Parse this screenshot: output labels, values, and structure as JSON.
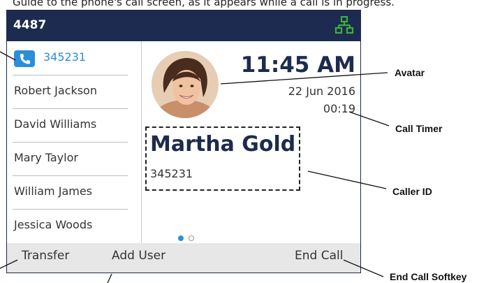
{
  "intro_text": "Guide to the phone's call screen, as it appears while a call is in progress.",
  "phone": {
    "extension": "4487",
    "icons": {
      "network": "network-icon",
      "phone": "phone-icon"
    },
    "contacts": [
      {
        "label": "345231",
        "active": true
      },
      {
        "label": "Robert Jackson"
      },
      {
        "label": "David Williams"
      },
      {
        "label": "Mary Taylor"
      },
      {
        "label": "William James"
      },
      {
        "label": "Jessica Woods"
      }
    ],
    "time": "11:45 AM",
    "date": "22 Jun 2016",
    "call_timer": "00:19",
    "caller_name": "Martha Gold",
    "caller_number": "345231",
    "page_indicator": {
      "count": 2,
      "active": 1
    },
    "softkeys": [
      "Transfer",
      "Add User",
      "End Call"
    ]
  },
  "callouts": {
    "avatar": "Avatar",
    "call_timer": "Call Timer",
    "caller_id": "Caller ID",
    "end_call": "End Call Softkey"
  },
  "colors": {
    "header": "#1c2b4f",
    "accent": "#2a8fd8",
    "network_icon": "#3db03d",
    "softkey_bar": "#e7e7e7"
  }
}
